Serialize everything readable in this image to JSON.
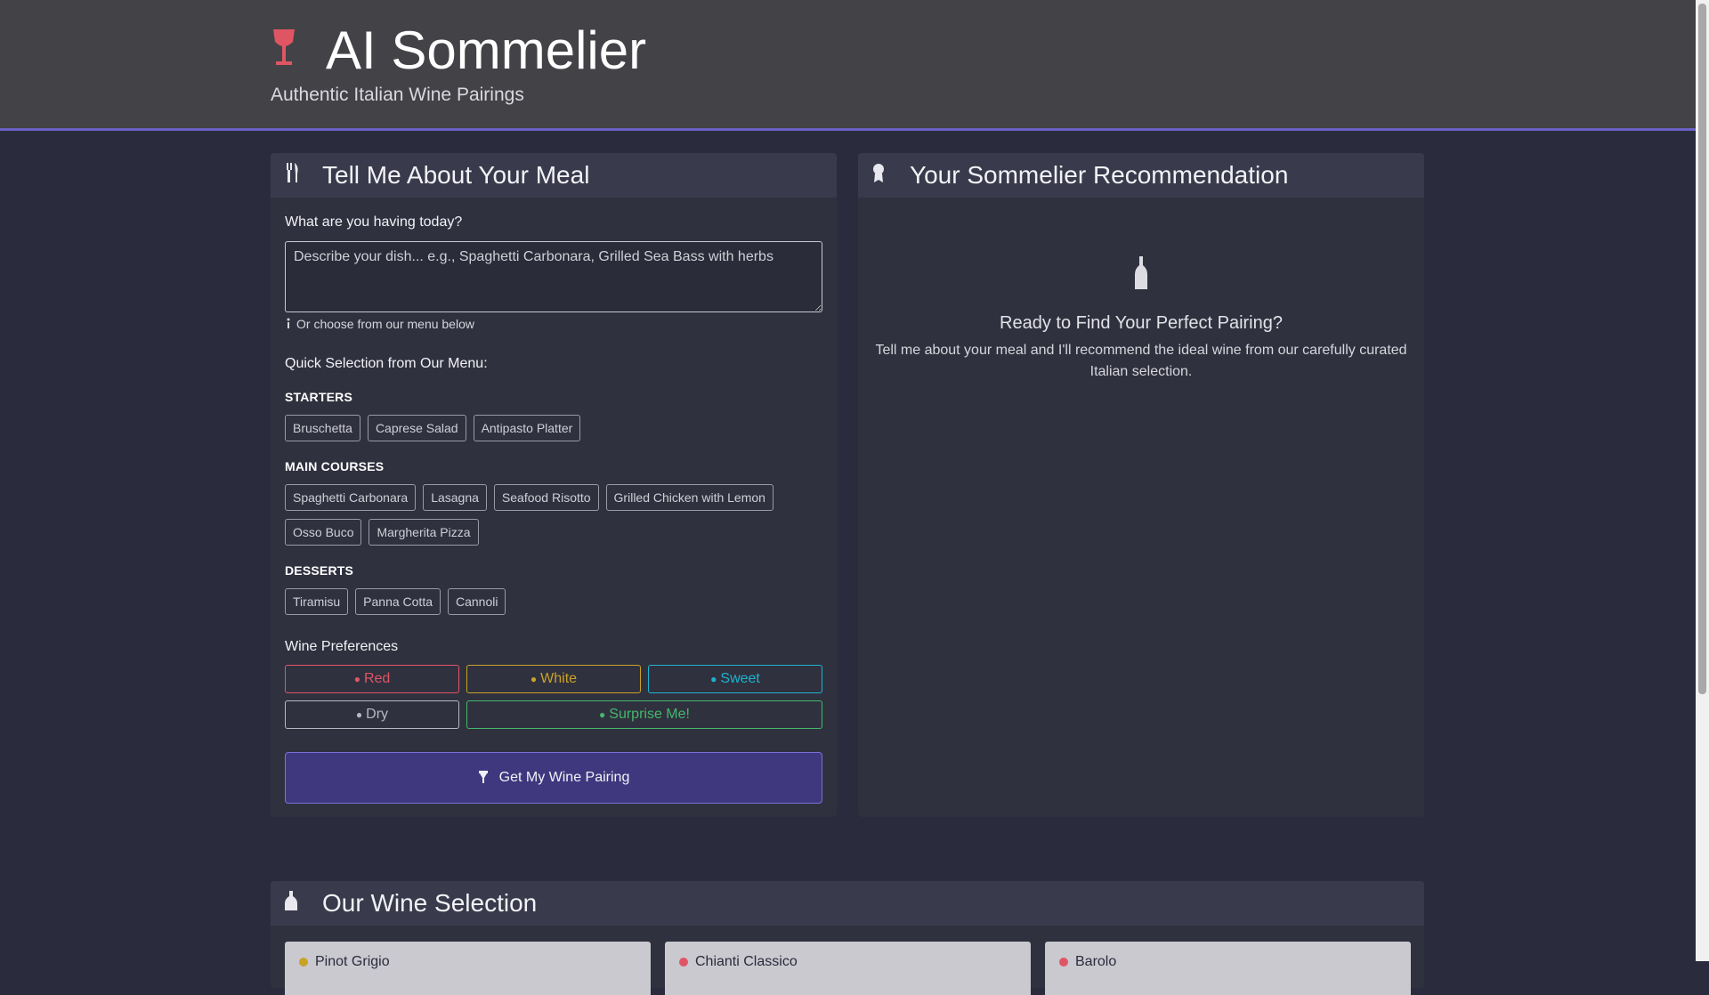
{
  "header": {
    "title": "AI Sommelier",
    "subtitle": "Authentic Italian Wine Pairings",
    "icon": "wine-glass-icon",
    "accent_color": "#e05564"
  },
  "meal_panel": {
    "title": "Tell Me About Your Meal",
    "icon": "utensils-icon",
    "question": "What are you having today?",
    "input_placeholder": "Describe your dish... e.g., Spaghetti Carbonara, Grilled Sea Bass with herbs",
    "input_value": "",
    "hint": "Or choose from our menu below",
    "quick_select_label": "Quick Selection from Our Menu:",
    "sections": [
      {
        "title": "STARTERS",
        "items": [
          "Bruschetta",
          "Caprese Salad",
          "Antipasto Platter"
        ]
      },
      {
        "title": "MAIN COURSES",
        "items": [
          "Spaghetti Carbonara",
          "Lasagna",
          "Seafood Risotto",
          "Grilled Chicken with Lemon",
          "Osso Buco",
          "Margherita Pizza"
        ]
      },
      {
        "title": "DESSERTS",
        "items": [
          "Tiramisu",
          "Panna Cotta",
          "Cannoli"
        ]
      }
    ],
    "preferences_label": "Wine Preferences",
    "preferences": [
      {
        "label": "Red",
        "color": "#e05564"
      },
      {
        "label": "White",
        "color": "#c9a227"
      },
      {
        "label": "Sweet",
        "color": "#1fb3cf"
      },
      {
        "label": "Dry",
        "color": "#b8b8c0"
      },
      {
        "label": "Surprise Me!",
        "color": "#43b86a"
      }
    ],
    "submit_label": "Get My Wine Pairing"
  },
  "recommendation_panel": {
    "title": "Your Sommelier Recommendation",
    "icon": "award-icon",
    "empty_icon": "wine-bottle-icon",
    "empty_title": "Ready to Find Your Perfect Pairing?",
    "empty_text": "Tell me about your meal and I'll recommend the ideal wine from our carefully curated Italian selection."
  },
  "wine_selection": {
    "title": "Our Wine Selection",
    "icon": "list-icon",
    "wines": [
      {
        "name": "Pinot Grigio",
        "color": "#c9a227"
      },
      {
        "name": "Chianti Classico",
        "color": "#e05564"
      },
      {
        "name": "Barolo",
        "color": "#e05564"
      }
    ]
  }
}
